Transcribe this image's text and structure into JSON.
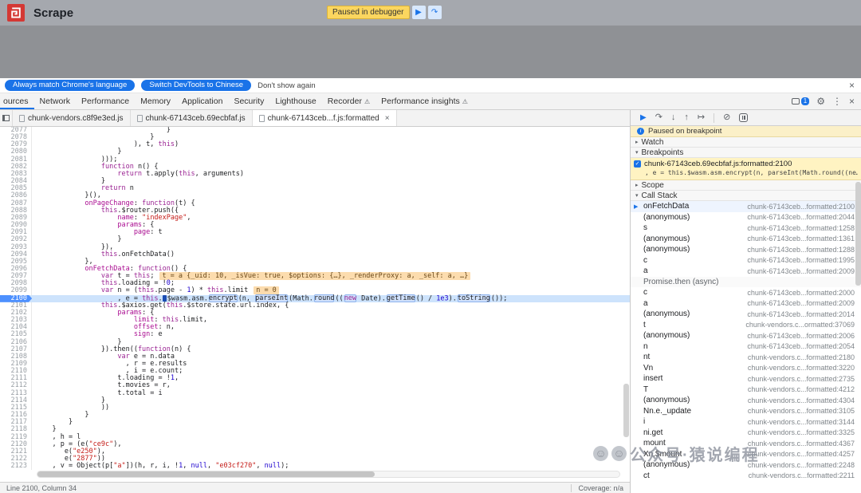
{
  "colors": {
    "accent": "#1a73e8",
    "breakpoint_blue": "#4d90fe",
    "exec_line": "#cde3fc",
    "paused_yellow": "#fbd65f",
    "logo_red": "#d43834",
    "string_red": "#c41a16",
    "keyword_purple": "#9b2393",
    "number_blue": "#1c00cf"
  },
  "icons": {
    "resume": "▶",
    "step_over": "↷",
    "step_into": "↓",
    "step_out": "↑",
    "step": "↦",
    "deactivate_breakpoints": "⊘",
    "gear": "⚙",
    "more": "⋮",
    "close": "×",
    "warning": "⚠",
    "check": "✓",
    "info": "i",
    "collapsed": "▸",
    "expanded": "▾",
    "play": "▶",
    "face": "☺"
  },
  "site": {
    "title": "Scrape",
    "paused_label": "Paused in debugger"
  },
  "infobar": {
    "match_language": "Always match Chrome's language",
    "switch_chinese": "Switch DevTools to Chinese",
    "dismiss": "Don't show again"
  },
  "devtools_tabs": {
    "badge": "1",
    "items": [
      {
        "label": "ources",
        "selected": true
      },
      {
        "label": "Network"
      },
      {
        "label": "Performance"
      },
      {
        "label": "Memory"
      },
      {
        "label": "Application"
      },
      {
        "label": "Security"
      },
      {
        "label": "Lighthouse"
      },
      {
        "label": "Recorder",
        "warn": true
      },
      {
        "label": "Performance insights",
        "warn": true
      }
    ]
  },
  "file_tabs": [
    {
      "label": "chunk-vendors.c8f9e3ed.js"
    },
    {
      "label": "chunk-67143ceb.69ecbfaf.js"
    },
    {
      "label": "chunk-67143ceb...f.js:formatted",
      "active": true,
      "closable": true
    }
  ],
  "statusbar": {
    "position": "Line 2100, Column 34",
    "coverage": "Coverage: n/a"
  },
  "editor": {
    "lines": [
      {
        "num": 2077,
        "ind": 32,
        "seg": [
          [
            "p",
            "}"
          ]
        ]
      },
      {
        "num": 2078,
        "ind": 28,
        "seg": [
          [
            "p",
            "}"
          ]
        ]
      },
      {
        "num": 2079,
        "ind": 24,
        "seg": [
          [
            "p",
            "), t, "
          ],
          [
            "k",
            "this"
          ],
          [
            "p",
            ")"
          ]
        ]
      },
      {
        "num": 2080,
        "ind": 20,
        "seg": [
          [
            "p",
            "}"
          ]
        ]
      },
      {
        "num": 2081,
        "ind": 16,
        "seg": [
          [
            "p",
            ")));"
          ]
        ]
      },
      {
        "num": 2082,
        "ind": 16,
        "seg": [
          [
            "k",
            "function"
          ],
          [
            "p",
            " n() {"
          ]
        ]
      },
      {
        "num": 2083,
        "ind": 20,
        "seg": [
          [
            "k",
            "return"
          ],
          [
            "p",
            " t.apply("
          ],
          [
            "k",
            "this"
          ],
          [
            "p",
            ", arguments)"
          ]
        ]
      },
      {
        "num": 2084,
        "ind": 16,
        "seg": [
          [
            "p",
            "}"
          ]
        ]
      },
      {
        "num": 2085,
        "ind": 16,
        "seg": [
          [
            "k",
            "return"
          ],
          [
            "p",
            " n"
          ]
        ]
      },
      {
        "num": 2086,
        "ind": 12,
        "seg": [
          [
            "p",
            "}(),"
          ]
        ]
      },
      {
        "num": 2087,
        "ind": 12,
        "seg": [
          [
            "pr",
            "onPageChange"
          ],
          [
            "p",
            ": "
          ],
          [
            "k",
            "function"
          ],
          [
            "p",
            "(t) {"
          ]
        ]
      },
      {
        "num": 2088,
        "ind": 16,
        "seg": [
          [
            "k",
            "this"
          ],
          [
            "p",
            ".$router.push({"
          ]
        ]
      },
      {
        "num": 2089,
        "ind": 20,
        "seg": [
          [
            "pr",
            "name"
          ],
          [
            "p",
            ": "
          ],
          [
            "s",
            "\"indexPage\""
          ],
          [
            "p",
            ","
          ]
        ]
      },
      {
        "num": 2090,
        "ind": 20,
        "seg": [
          [
            "pr",
            "params"
          ],
          [
            "p",
            ": {"
          ]
        ]
      },
      {
        "num": 2091,
        "ind": 24,
        "seg": [
          [
            "pr",
            "page"
          ],
          [
            "p",
            ": t"
          ]
        ]
      },
      {
        "num": 2092,
        "ind": 20,
        "seg": [
          [
            "p",
            "}"
          ]
        ]
      },
      {
        "num": 2093,
        "ind": 16,
        "seg": [
          [
            "p",
            "}),"
          ]
        ]
      },
      {
        "num": 2094,
        "ind": 16,
        "seg": [
          [
            "k",
            "this"
          ],
          [
            "p",
            ".onFetchData()"
          ]
        ]
      },
      {
        "num": 2095,
        "ind": 12,
        "seg": [
          [
            "p",
            "},"
          ]
        ]
      },
      {
        "num": 2096,
        "ind": 12,
        "seg": [
          [
            "pr",
            "onFetchData"
          ],
          [
            "p",
            ": "
          ],
          [
            "k",
            "function"
          ],
          [
            "p",
            "() {"
          ]
        ]
      },
      {
        "num": 2097,
        "ind": 16,
        "seg": [
          [
            "k",
            "var"
          ],
          [
            "p",
            " t = "
          ],
          [
            "k",
            "this"
          ],
          [
            "p",
            ";"
          ]
        ],
        "inline": "t = a {_uid: 10, _isVue: true, $options: {…}, _renderProxy: a, _self: a, …}"
      },
      {
        "num": 2098,
        "ind": 16,
        "seg": [
          [
            "k",
            "this"
          ],
          [
            "p",
            ".loading = !"
          ],
          [
            "n",
            "0"
          ],
          [
            "p",
            ";"
          ]
        ]
      },
      {
        "num": 2099,
        "ind": 16,
        "seg": [
          [
            "k",
            "var"
          ],
          [
            "p",
            " n = ("
          ],
          [
            "k",
            "this"
          ],
          [
            "p",
            ".page - "
          ],
          [
            "n",
            "1"
          ],
          [
            "p",
            ") * "
          ],
          [
            "k",
            "this"
          ],
          [
            "p",
            ".limit"
          ]
        ],
        "inline": "n = 0"
      },
      {
        "num": 2100,
        "ind": 20,
        "exec": true,
        "seg": [
          [
            "p",
            ", e = "
          ],
          [
            "k",
            "this"
          ],
          [
            "p",
            "."
          ],
          [
            "cur",
            ""
          ],
          [
            "p",
            "$wasm.asm."
          ],
          [
            "bp",
            "encrypt"
          ],
          [
            "p",
            "(n, "
          ],
          [
            "bp",
            "parseInt"
          ],
          [
            "p",
            "(Math."
          ],
          [
            "bp",
            "round"
          ],
          [
            "p",
            "(("
          ],
          [
            "bpk",
            "new"
          ],
          [
            "p",
            " Date)."
          ],
          [
            "bp",
            "getTime"
          ],
          [
            "p",
            "() / "
          ],
          [
            "n",
            "1e3"
          ],
          [
            "p",
            ")."
          ],
          [
            "bp",
            "toString"
          ],
          [
            "p",
            "());"
          ]
        ]
      },
      {
        "num": 2101,
        "ind": 16,
        "seg": [
          [
            "k",
            "this"
          ],
          [
            "p",
            ".$axios.get("
          ],
          [
            "k",
            "this"
          ],
          [
            "p",
            ".$store.state.url.index, {"
          ]
        ]
      },
      {
        "num": 2102,
        "ind": 20,
        "seg": [
          [
            "pr",
            "params"
          ],
          [
            "p",
            ": {"
          ]
        ]
      },
      {
        "num": 2103,
        "ind": 24,
        "seg": [
          [
            "pr",
            "limit"
          ],
          [
            "p",
            ": "
          ],
          [
            "k",
            "this"
          ],
          [
            "p",
            ".limit,"
          ]
        ]
      },
      {
        "num": 2104,
        "ind": 24,
        "seg": [
          [
            "pr",
            "offset"
          ],
          [
            "p",
            ": n,"
          ]
        ]
      },
      {
        "num": 2105,
        "ind": 24,
        "seg": [
          [
            "pr",
            "sign"
          ],
          [
            "p",
            ": e"
          ]
        ]
      },
      {
        "num": 2106,
        "ind": 20,
        "seg": [
          [
            "p",
            "}"
          ]
        ]
      },
      {
        "num": 2107,
        "ind": 16,
        "seg": [
          [
            "p",
            "}).then(("
          ],
          [
            "k",
            "function"
          ],
          [
            "p",
            "(n) {"
          ]
        ]
      },
      {
        "num": 2108,
        "ind": 20,
        "seg": [
          [
            "k",
            "var"
          ],
          [
            "p",
            " e = n.data"
          ]
        ]
      },
      {
        "num": 2109,
        "ind": 22,
        "seg": [
          [
            "p",
            ", r = e.results"
          ]
        ]
      },
      {
        "num": 2110,
        "ind": 22,
        "seg": [
          [
            "p",
            ", i = e.count;"
          ]
        ]
      },
      {
        "num": 2111,
        "ind": 20,
        "seg": [
          [
            "p",
            "t.loading = !"
          ],
          [
            "n",
            "1"
          ],
          [
            "p",
            ","
          ]
        ]
      },
      {
        "num": 2112,
        "ind": 20,
        "seg": [
          [
            "p",
            "t.movies = r,"
          ]
        ]
      },
      {
        "num": 2113,
        "ind": 20,
        "seg": [
          [
            "p",
            "t.total = i"
          ]
        ]
      },
      {
        "num": 2114,
        "ind": 16,
        "seg": [
          [
            "p",
            "}"
          ]
        ]
      },
      {
        "num": 2115,
        "ind": 16,
        "seg": [
          [
            "p",
            "))"
          ]
        ]
      },
      {
        "num": 2116,
        "ind": 12,
        "seg": [
          [
            "p",
            "}"
          ]
        ]
      },
      {
        "num": 2117,
        "ind": 8,
        "seg": [
          [
            "p",
            "}"
          ]
        ]
      },
      {
        "num": 2118,
        "ind": 4,
        "seg": [
          [
            "p",
            "}"
          ]
        ]
      },
      {
        "num": 2119,
        "ind": 4,
        "seg": [
          [
            "p",
            ", h = l"
          ]
        ]
      },
      {
        "num": 2120,
        "ind": 4,
        "seg": [
          [
            "p",
            ", p = (e("
          ],
          [
            "s",
            "\"ce9c\""
          ],
          [
            "p",
            "),"
          ]
        ]
      },
      {
        "num": 2121,
        "ind": 7,
        "seg": [
          [
            "p",
            "e("
          ],
          [
            "s",
            "\"e250\""
          ],
          [
            "p",
            "),"
          ]
        ]
      },
      {
        "num": 2122,
        "ind": 7,
        "seg": [
          [
            "p",
            "e("
          ],
          [
            "s",
            "\"2877\""
          ],
          [
            "p",
            "))"
          ]
        ]
      },
      {
        "num": 2123,
        "ind": 4,
        "seg": [
          [
            "p",
            ", v = Object(p["
          ],
          [
            "s",
            "\"a\""
          ],
          [
            "p",
            "])(h, r, i, !"
          ],
          [
            "n",
            "1"
          ],
          [
            "p",
            ", "
          ],
          [
            "n",
            "null"
          ],
          [
            "p",
            ", "
          ],
          [
            "s",
            "\"e03cf270\""
          ],
          [
            "p",
            ", "
          ],
          [
            "n",
            "null"
          ],
          [
            "p",
            ");"
          ]
        ]
      }
    ]
  },
  "debugger": {
    "paused_message": "Paused on breakpoint",
    "watch_label": "Watch",
    "breakpoints_label": "Breakpoints",
    "scope_label": "Scope",
    "callstack_label": "Call Stack",
    "breakpoint": {
      "title": "chunk-67143ceb.69ecbfaf.js:formatted:2100",
      "snippet": ", e = this.$wasm.asm.encrypt(n, parseInt(Math.round((ne…"
    },
    "call_stack": [
      {
        "name": "onFetchData",
        "loc": "chunk-67143ceb...formatted:2100",
        "active": true
      },
      {
        "name": "(anonymous)",
        "loc": "chunk-67143ceb...formatted:2044"
      },
      {
        "name": "s",
        "loc": "chunk-67143ceb...formatted:1258"
      },
      {
        "name": "(anonymous)",
        "loc": "chunk-67143ceb...formatted:1361"
      },
      {
        "name": "(anonymous)",
        "loc": "chunk-67143ceb...formatted:1288"
      },
      {
        "name": "c",
        "loc": "chunk-67143ceb...formatted:1995"
      },
      {
        "name": "a",
        "loc": "chunk-67143ceb...formatted:2009"
      },
      {
        "name": "Promise.then (async)",
        "async": true
      },
      {
        "name": "c",
        "loc": "chunk-67143ceb...formatted:2000"
      },
      {
        "name": "a",
        "loc": "chunk-67143ceb...formatted:2009"
      },
      {
        "name": "(anonymous)",
        "loc": "chunk-67143ceb...formatted:2014"
      },
      {
        "name": "t",
        "loc": "chunk-vendors.c...ormatted:37069"
      },
      {
        "name": "(anonymous)",
        "loc": "chunk-67143ceb...formatted:2006"
      },
      {
        "name": "n",
        "loc": "chunk-67143ceb...formatted:2054"
      },
      {
        "name": "nt",
        "loc": "chunk-vendors.c...formatted:2180"
      },
      {
        "name": "Vn",
        "loc": "chunk-vendors.c...formatted:3220"
      },
      {
        "name": "insert",
        "loc": "chunk-vendors.c...formatted:2735"
      },
      {
        "name": "T",
        "loc": "chunk-vendors.c...formatted:4212"
      },
      {
        "name": "(anonymous)",
        "loc": "chunk-vendors.c...formatted:4304"
      },
      {
        "name": "Nn.e._update",
        "loc": "chunk-vendors.c...formatted:3105"
      },
      {
        "name": "i",
        "loc": "chunk-vendors.c...formatted:3144"
      },
      {
        "name": "ni.get",
        "loc": "chunk-vendors.c...formatted:3325"
      },
      {
        "name": "mount",
        "loc": "chunk-vendors.c...formatted:4367"
      },
      {
        "name": "Xn.$mount",
        "loc": "chunk-vendors.c...formatted:4257"
      },
      {
        "name": "(anonymous)",
        "loc": "chunk-vendors.c...formatted:2248"
      },
      {
        "name": "ct",
        "loc": "chunk-vendors.c...formatted:2211"
      }
    ]
  },
  "watermark": {
    "text": "公众号·猿说编程"
  }
}
